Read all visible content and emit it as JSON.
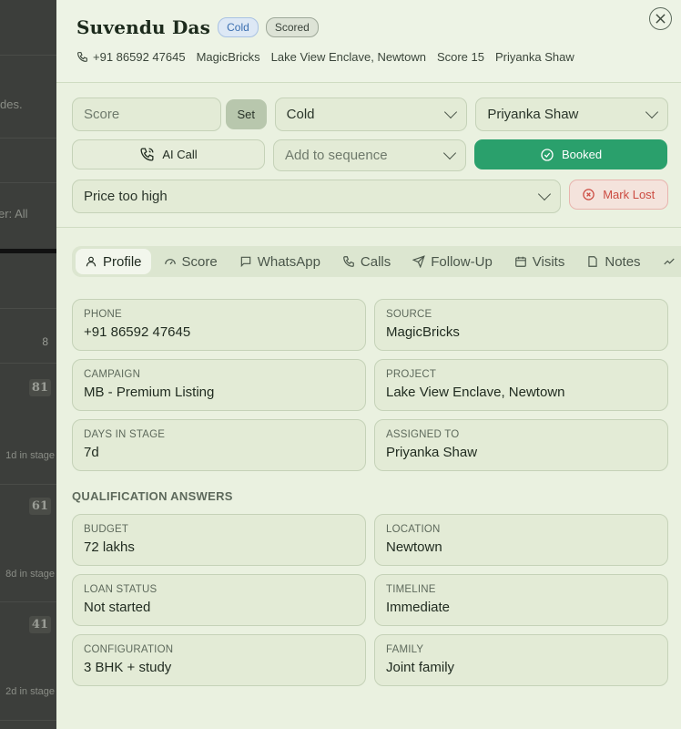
{
  "background": {
    "text_fragments": [
      "des.",
      "er: All"
    ],
    "scores": [
      "8",
      "81",
      "61",
      "41"
    ],
    "stages": [
      "1d in stage",
      "8d in stage",
      "2d in stage"
    ]
  },
  "lead": {
    "name": "Suvendu Das",
    "badges": [
      "Cold",
      "Scored"
    ],
    "phone": "+91 86592 47645",
    "source": "MagicBricks",
    "project": "Lake View Enclave, Newtown",
    "score_text": "Score 15",
    "assignee": "Priyanka Shaw"
  },
  "controls": {
    "score_placeholder": "Score",
    "set_label": "Set",
    "temperature": "Cold",
    "assignee": "Priyanka Shaw",
    "ai_call_label": "AI Call",
    "sequence_placeholder": "Add to sequence",
    "booked_label": "Booked",
    "lost_reason": "Price too high",
    "mark_lost_label": "Mark Lost"
  },
  "tabs": [
    {
      "label": "Profile",
      "icon": "user-icon",
      "active": true
    },
    {
      "label": "Score",
      "icon": "gauge-icon"
    },
    {
      "label": "WhatsApp",
      "icon": "chat-icon"
    },
    {
      "label": "Calls",
      "icon": "phone-icon"
    },
    {
      "label": "Follow-Up",
      "icon": "send-icon"
    },
    {
      "label": "Visits",
      "icon": "calendar-icon"
    },
    {
      "label": "Notes",
      "icon": "note-icon"
    }
  ],
  "profile": [
    {
      "label": "PHONE",
      "value": "+91 86592 47645"
    },
    {
      "label": "SOURCE",
      "value": "MagicBricks"
    },
    {
      "label": "CAMPAIGN",
      "value": "MB - Premium Listing"
    },
    {
      "label": "PROJECT",
      "value": "Lake View Enclave, Newtown"
    },
    {
      "label": "DAYS IN STAGE",
      "value": "7d"
    },
    {
      "label": "ASSIGNED TO",
      "value": "Priyanka Shaw"
    }
  ],
  "qualification": {
    "title": "QUALIFICATION ANSWERS",
    "items": [
      {
        "label": "BUDGET",
        "value": "72 lakhs"
      },
      {
        "label": "LOCATION",
        "value": "Newtown"
      },
      {
        "label": "LOAN STATUS",
        "value": "Not started"
      },
      {
        "label": "TIMELINE",
        "value": "Immediate"
      },
      {
        "label": "CONFIGURATION",
        "value": "3 BHK + study"
      },
      {
        "label": "FAMILY",
        "value": "Joint family"
      }
    ]
  }
}
